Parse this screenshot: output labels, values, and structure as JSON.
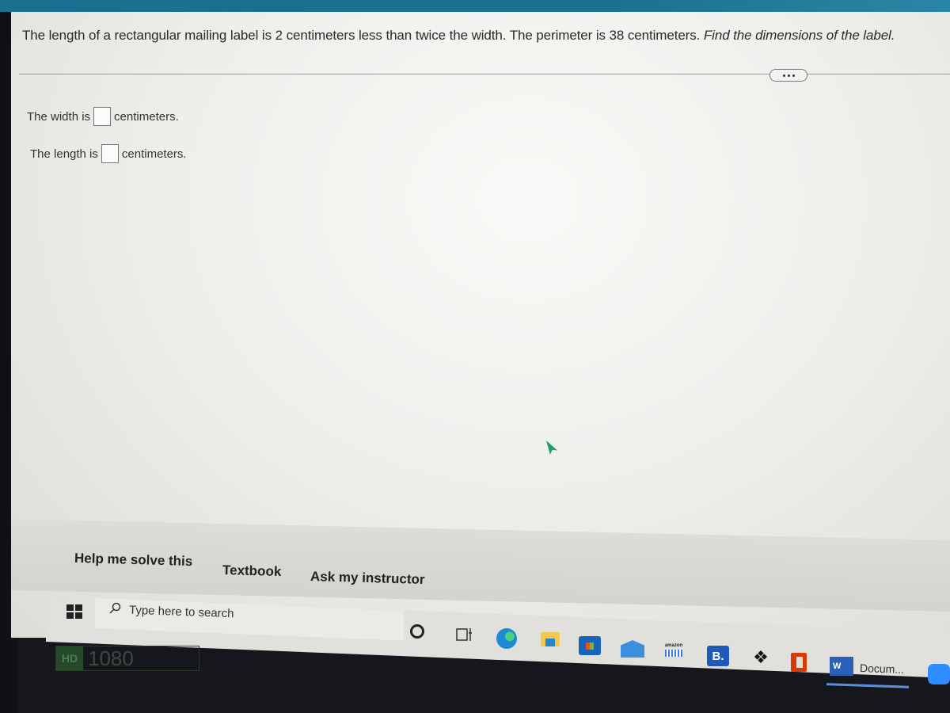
{
  "question": {
    "text": "The length of a rectangular mailing label is 2 centimeters less than twice the width. The perimeter is 38 centimeters.",
    "instruction": "Find the dimensions of the label."
  },
  "more_button": {
    "icon": "ellipsis-icon"
  },
  "answers": [
    {
      "prefix": "The width is",
      "value": "",
      "suffix": "centimeters."
    },
    {
      "prefix": "The length is",
      "value": "",
      "suffix": "centimeters."
    }
  ],
  "help_links": {
    "solve": "Help me solve this",
    "textbook": "Textbook",
    "instructor": "Ask my instructor"
  },
  "taskbar": {
    "search_placeholder": "Type here to search",
    "apps": [
      "cortana",
      "task-view",
      "edge",
      "file-explorer",
      "microsoft-store",
      "mail",
      "amazon",
      "booking",
      "dropbox",
      "office",
      "word",
      "zoom"
    ],
    "amazon_label": "amazon",
    "booking_label": "B.",
    "word_icon_label": "W",
    "word_window_label": "Docum..."
  },
  "bezel_sticker": {
    "hd": "HD",
    "resolution": "1080"
  }
}
